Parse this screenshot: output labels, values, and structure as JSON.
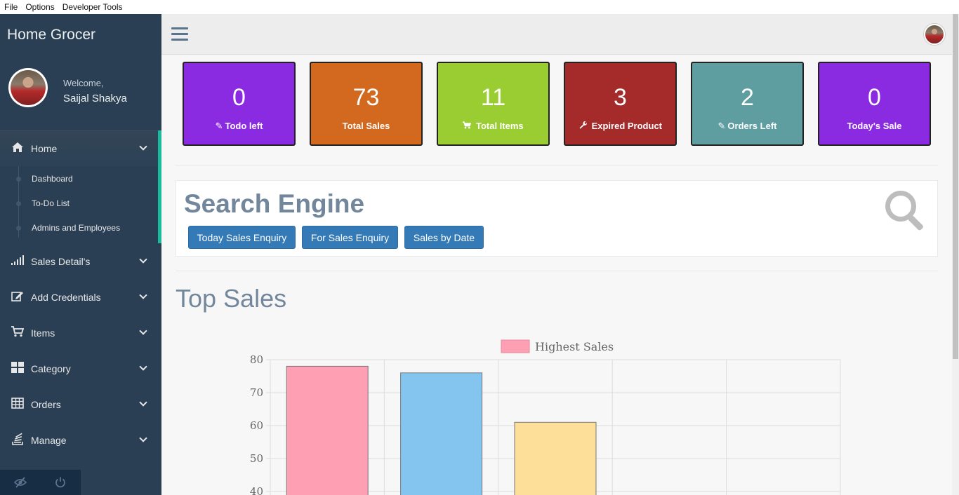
{
  "menubar": {
    "items": [
      "File",
      "Options",
      "Developer Tools"
    ]
  },
  "sidebar": {
    "brand": "Home Grocer",
    "welcome": "Welcome,",
    "username": "Saijal Shakya",
    "home": {
      "label": "Home",
      "icon": "home-icon"
    },
    "subitems": [
      "Dashboard",
      "To-Do List",
      "Admins and Employees"
    ],
    "items": [
      {
        "label": "Sales Detail's",
        "icon": "signal-icon"
      },
      {
        "label": "Add Credentials",
        "icon": "edit-icon"
      },
      {
        "label": "Items",
        "icon": "cart-icon"
      },
      {
        "label": "Category",
        "icon": "grid-icon"
      },
      {
        "label": "Orders",
        "icon": "table-icon"
      },
      {
        "label": "Manage",
        "icon": "stack-icon"
      }
    ],
    "footer_icons": [
      "eye-slash-icon",
      "power-icon"
    ]
  },
  "tiles": [
    {
      "value": "0",
      "label": "Todo left",
      "icon": "pencil-icon",
      "color": "#8a2be2"
    },
    {
      "value": "73",
      "label": "Total Sales",
      "icon": "",
      "color": "#d2691e"
    },
    {
      "value": "11",
      "label": "Total Items",
      "icon": "cart-icon",
      "color": "#9acd32"
    },
    {
      "value": "3",
      "label": "Expired Product",
      "icon": "wrench-icon",
      "color": "#a52a2a"
    },
    {
      "value": "2",
      "label": "Orders Left",
      "icon": "pencil-icon",
      "color": "#5f9ea0"
    },
    {
      "value": "0",
      "label": "Today's Sale",
      "icon": "",
      "color": "#8a2be2"
    }
  ],
  "search": {
    "title": "Search Engine",
    "buttons": [
      "Today Sales Enquiry",
      "For Sales Enquiry",
      "Sales by Date"
    ]
  },
  "top_sales": {
    "title": "Top Sales"
  },
  "chart_data": {
    "type": "bar",
    "legend": "Highest Sales",
    "legend_position": "top",
    "values": [
      78,
      76,
      61
    ],
    "colors": [
      "#ff9fb3",
      "#84c5f0",
      "#fddf9a"
    ],
    "yticks": [
      "80",
      "70",
      "60",
      "50",
      "40"
    ],
    "ylim": [
      40,
      80
    ],
    "grid": true
  }
}
